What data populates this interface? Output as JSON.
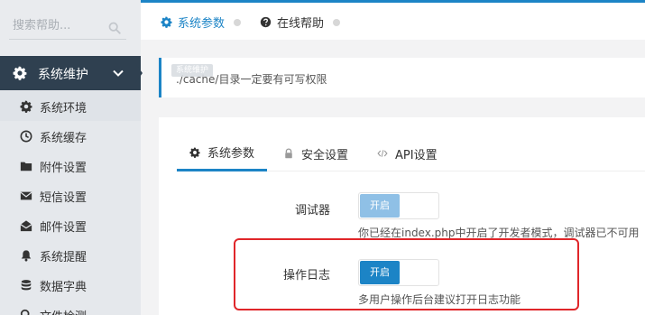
{
  "sidebar": {
    "search_placeholder": "搜索帮助...",
    "active_menu": "系统维护",
    "items": [
      {
        "label": "系统环境",
        "icon": "gear-icon"
      },
      {
        "label": "系统缓存",
        "icon": "clock-icon"
      },
      {
        "label": "附件设置",
        "icon": "folder-icon"
      },
      {
        "label": "短信设置",
        "icon": "envelope-icon"
      },
      {
        "label": "邮件设置",
        "icon": "envelope-open-icon"
      },
      {
        "label": "系统提醒",
        "icon": "bell-icon"
      },
      {
        "label": "数据字典",
        "icon": "database-icon"
      },
      {
        "label": "文件检测",
        "icon": "search-icon"
      }
    ]
  },
  "topbar": {
    "tabs": [
      {
        "label": "系统参数",
        "icon": "gear-icon",
        "active": true
      },
      {
        "label": "在线帮助",
        "icon": "question-icon",
        "active": false
      }
    ]
  },
  "notice": {
    "tooltip": "系统维护",
    "text": "./cache/目录一定要有可写权限"
  },
  "panel": {
    "tabs": [
      {
        "label": "系统参数",
        "icon": "gear-icon",
        "active": true
      },
      {
        "label": "安全设置",
        "icon": "lock-icon",
        "active": false
      },
      {
        "label": "API设置",
        "icon": "code-icon",
        "active": false
      }
    ],
    "debugger": {
      "label": "调试器",
      "toggle": "开启",
      "help": "你已经在index.php中开启了开发者模式，调试器已不可用"
    },
    "oplog": {
      "label": "操作日志",
      "toggle": "开启",
      "help": "多用户操作后台建议打开日志功能"
    }
  },
  "colors": {
    "accent": "#1c84c6",
    "sidebar_active": "#2f4050",
    "highlight": "#e0262a"
  }
}
